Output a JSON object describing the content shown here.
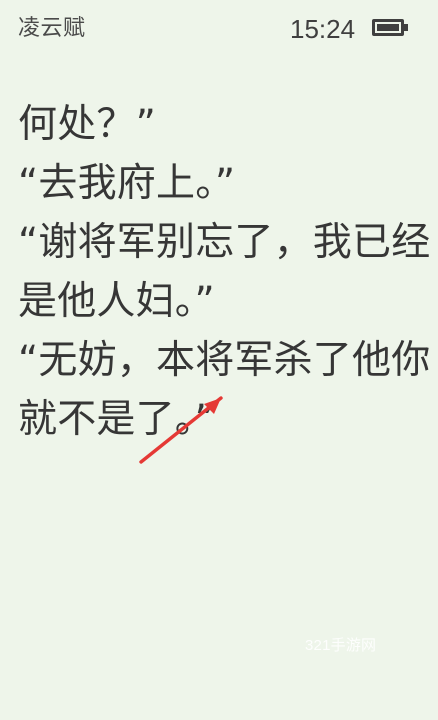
{
  "statusBar": {
    "title": "凌云赋",
    "time": "15:24",
    "batteryIcon": "battery-icon"
  },
  "reader": {
    "lines": [
      "何处？”",
      "“去我府上。”",
      "“谢将军别忘了，我已经",
      "是他人妇。”",
      "“无妨，本将军杀了他你",
      "就不是了。”"
    ]
  },
  "annotation": {
    "icon": "arrow-icon",
    "color": "#e53935"
  },
  "watermark": {
    "text": "321手游网"
  }
}
